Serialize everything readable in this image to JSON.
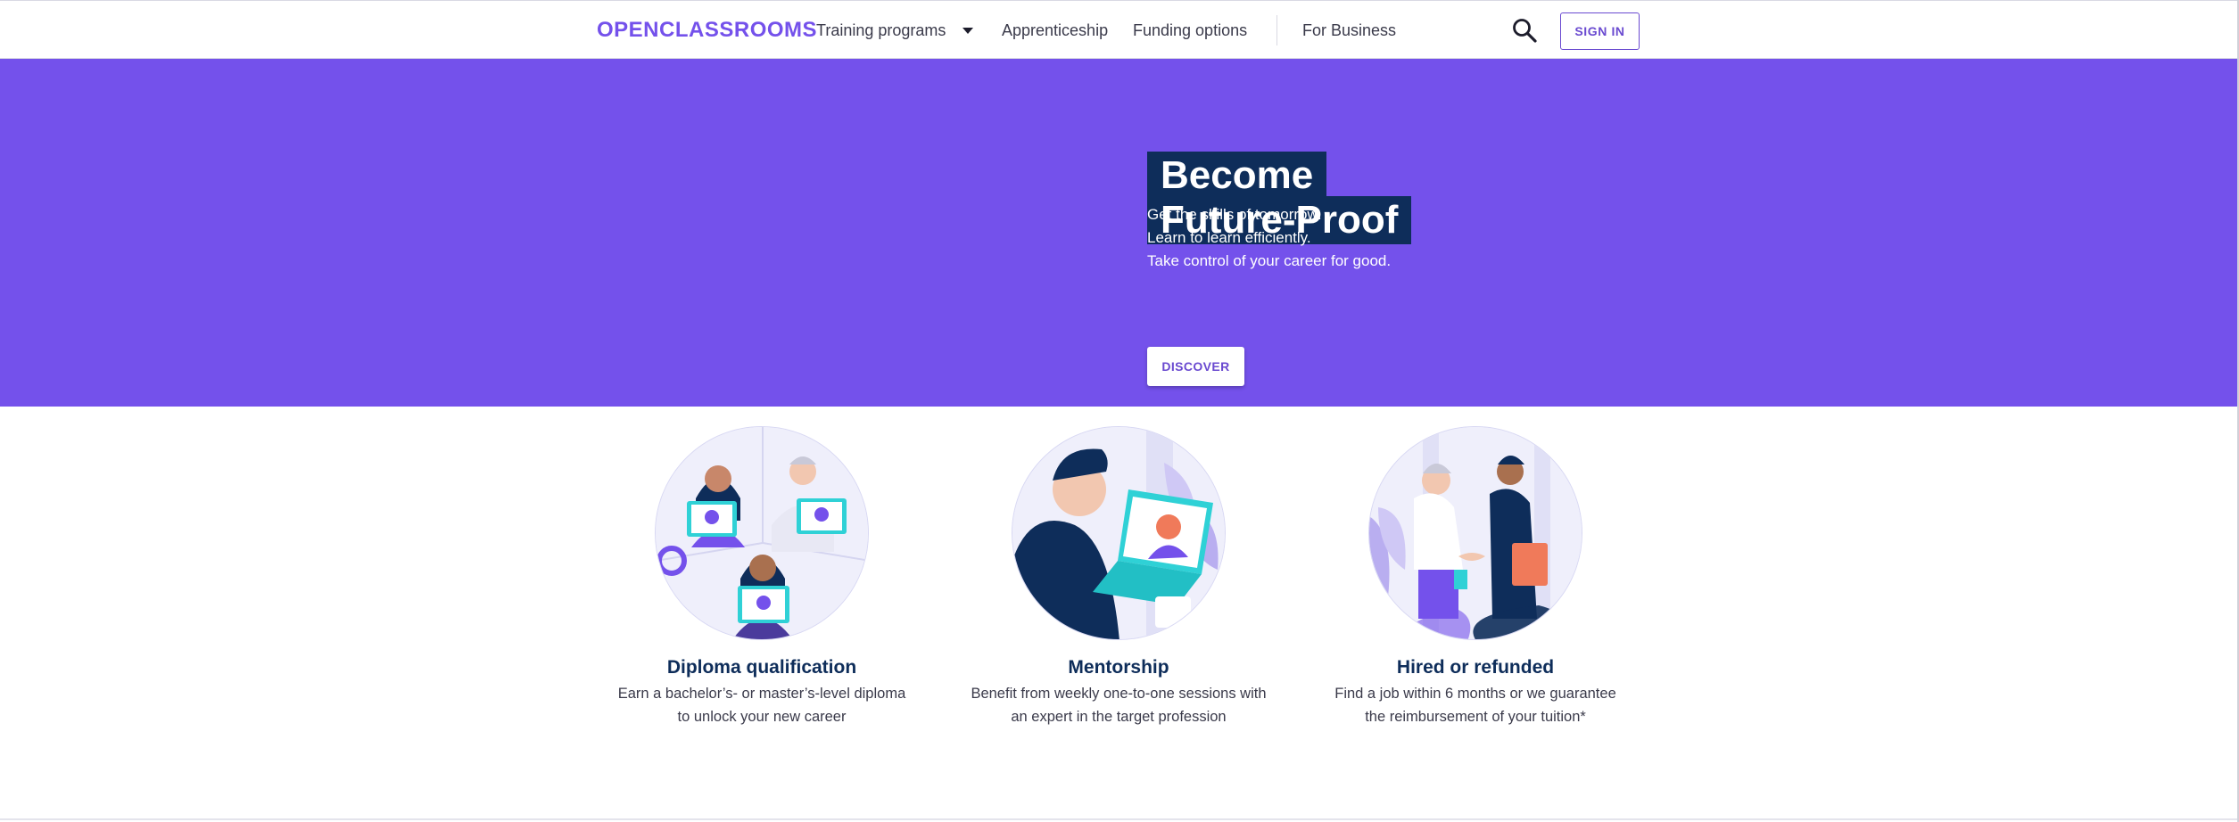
{
  "nav": {
    "logo": "OPENCLASSROOMS",
    "training": "Training programs",
    "apprenticeship": "Apprenticeship",
    "funding": "Funding options",
    "business": "For Business",
    "signin": "SIGN IN"
  },
  "hero": {
    "title_line1": "Become",
    "title_line2": "Future-Proof",
    "line1": "Get the skills of tomorrow.",
    "line2": "Learn to learn efficiently.",
    "line3": "Take control of your career for good.",
    "cta": "DISCOVER"
  },
  "features": [
    {
      "title": "Diploma qualification",
      "desc1": "Earn a bachelor’s- or master’s-level diploma",
      "desc2": "to unlock your new career"
    },
    {
      "title": "Mentorship",
      "desc1": "Benefit from weekly one-to-one sessions with",
      "desc2": "an expert in the target profession"
    },
    {
      "title": "Hired or refunded",
      "desc1": "Find a job within 6 months or we guarantee",
      "desc2": "the reimbursement of your tuition*"
    }
  ],
  "colors": {
    "brand_purple": "#7451eb",
    "navy": "#0e2d5a",
    "accent_teal": "#2fd1d6"
  },
  "icons": {
    "search": "search-icon",
    "dropdown": "caret-down-icon"
  }
}
